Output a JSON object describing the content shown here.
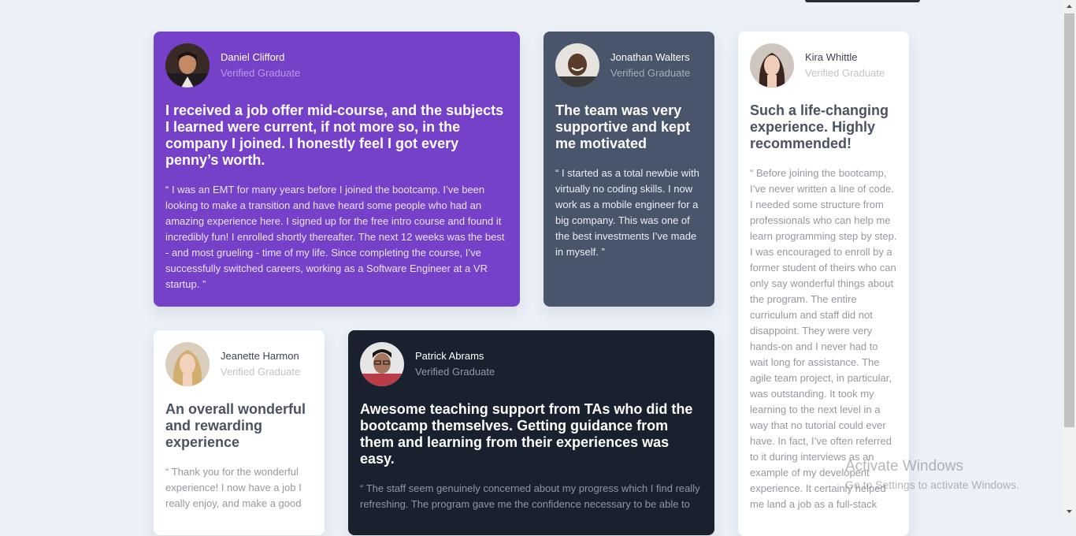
{
  "colors": {
    "page_bg": "#ecf1f8",
    "purple": "#7541c8",
    "slate": "#48556a",
    "white": "#ffffff",
    "dark": "#19212e"
  },
  "testimonials": [
    {
      "name": "Daniel Clifford",
      "role": "Verified Graduate",
      "headline": "I received a job offer mid-course, and the subjects I learned were current, if not more so, in the company I joined. I honestly feel I got every penny’s worth.",
      "quote": "“ I was an EMT for many years before I joined the bootcamp. I’ve been looking to make a transition and have heard some people who had an amazing experience here. I signed up for the free intro course and found it incredibly fun! I enrolled shortly thereafter. The next 12 weeks was the best - and most grueling - time of my life. Since completing the course, I’ve successfully switched careers, working as a Software Engineer at a VR startup. ”"
    },
    {
      "name": "Jonathan Walters",
      "role": "Verified Graduate",
      "headline": "The team was very supportive and kept me motivated",
      "quote": "“ I started as a total newbie with virtually no coding skills. I now work as a mobile engineer for a big company. This was one of the best investments I’ve made in myself. ”"
    },
    {
      "name": "Kira Whittle",
      "role": "Verified Graduate",
      "headline": "Such a life-changing experience. Highly recommended!",
      "quote": "“ Before joining the bootcamp, I’ve never written a line of code. I needed some structure from professionals who can help me learn programming step by step. I was encouraged to enroll by a former student of theirs who can only say wonderful things about the program. The entire curriculum and staff did not disappoint. They were very hands-on and I never had to wait long for assistance. The agile team project, in particular, was outstanding. It took my learning to the next level in a way that no tutorial could ever have. In fact, I’ve often referred to it during interviews as an example of my developent experience. It certainly helped me land a job as a full-stack"
    },
    {
      "name": "Jeanette Harmon",
      "role": "Verified Graduate",
      "headline": "An overall wonderful and rewarding experience",
      "quote": "“ Thank you for the wonderful experience! I now have a job I really enjoy, and make a good"
    },
    {
      "name": "Patrick Abrams",
      "role": "Verified Graduate",
      "headline": "Awesome teaching support from TAs who did the bootcamp themselves. Getting guidance from them and learning from their experiences was easy.",
      "quote": "“ The staff seem genuinely concerned about my progress which I find really refreshing. The program gave me the confidence necessary to be able to"
    }
  ],
  "watermark": {
    "title": "Activate Windows",
    "subtitle": "Go to Settings to activate Windows."
  }
}
